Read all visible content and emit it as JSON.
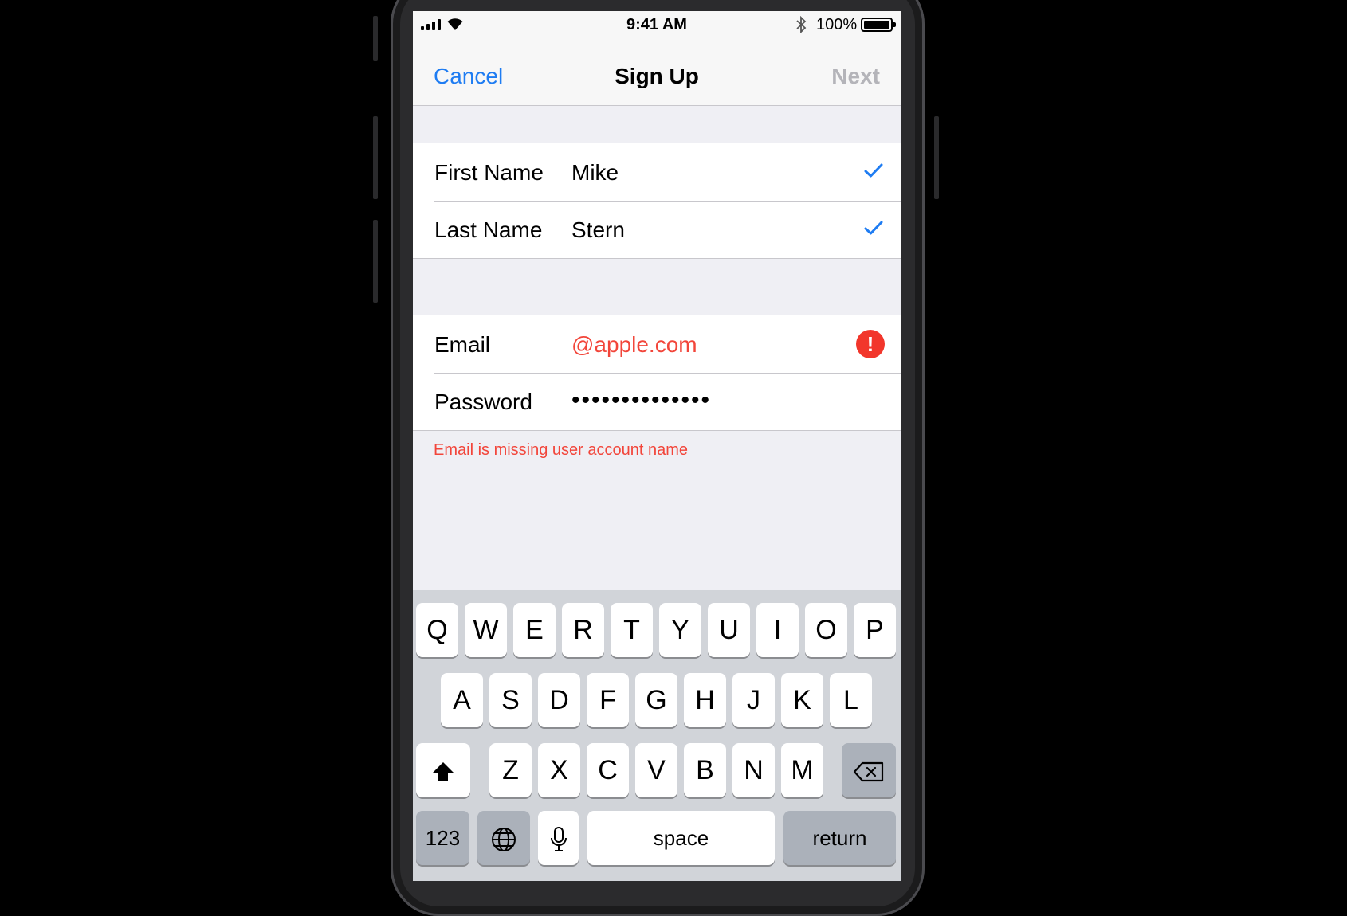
{
  "status_bar": {
    "time": "9:41 AM",
    "battery": "100%"
  },
  "nav": {
    "cancel": "Cancel",
    "title": "Sign Up",
    "next": "Next"
  },
  "form": {
    "name_section": [
      {
        "label": "First Name",
        "value": "Mike",
        "status": "valid"
      },
      {
        "label": "Last Name",
        "value": "Stern",
        "status": "valid"
      }
    ],
    "account_section": [
      {
        "label": "Email",
        "value": "@apple.com",
        "status": "error"
      },
      {
        "label": "Password",
        "value": "••••••••••••••",
        "status": "none"
      }
    ],
    "error_message": "Email is missing user account name",
    "alert_glyph": "!"
  },
  "keyboard": {
    "row1": [
      "Q",
      "W",
      "E",
      "R",
      "T",
      "Y",
      "U",
      "I",
      "O",
      "P"
    ],
    "row2": [
      "A",
      "S",
      "D",
      "F",
      "G",
      "H",
      "J",
      "K",
      "L"
    ],
    "row3": [
      "Z",
      "X",
      "C",
      "V",
      "B",
      "N",
      "M"
    ],
    "numbers": "123",
    "space": "space",
    "return": "return"
  },
  "colors": {
    "accent": "#1e7cf2",
    "error": "#f2453a",
    "disabled": "#b4b4b9"
  }
}
